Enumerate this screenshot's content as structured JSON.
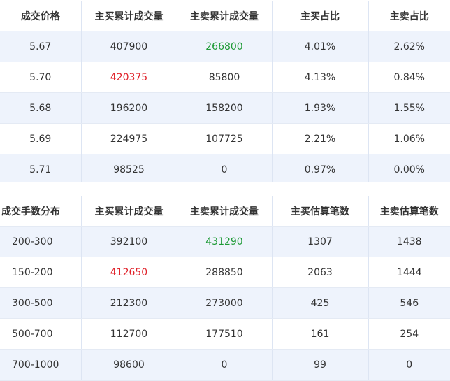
{
  "colors": {
    "up": "#e0222a",
    "down": "#1e9a36",
    "row_alt_bg": "#eef3fc"
  },
  "price_table": {
    "headers": [
      "成交价格",
      "主买累计成交量",
      "主卖累计成交量",
      "主买占比",
      "主卖占比"
    ],
    "rows": [
      {
        "price": "5.67",
        "buy_volume": "407900",
        "sell_volume": "266800",
        "buy_ratio": "4.01%",
        "sell_ratio": "2.62%"
      },
      {
        "price": "5.70",
        "buy_volume": "420375",
        "sell_volume": "85800",
        "buy_ratio": "4.13%",
        "sell_ratio": "0.84%"
      },
      {
        "price": "5.68",
        "buy_volume": "196200",
        "sell_volume": "158200",
        "buy_ratio": "1.93%",
        "sell_ratio": "1.55%"
      },
      {
        "price": "5.69",
        "buy_volume": "224975",
        "sell_volume": "107725",
        "buy_ratio": "2.21%",
        "sell_ratio": "1.06%"
      },
      {
        "price": "5.71",
        "buy_volume": "98525",
        "sell_volume": "0",
        "buy_ratio": "0.97%",
        "sell_ratio": "0.00%"
      }
    ]
  },
  "lot_table": {
    "headers": [
      "成交手数分布",
      "主买累计成交量",
      "主卖累计成交量",
      "主买估算笔数",
      "主卖估算笔数"
    ],
    "rows": [
      {
        "range": "200-300",
        "buy_volume": "392100",
        "sell_volume": "431290",
        "buy_count": "1307",
        "sell_count": "1438"
      },
      {
        "range": "150-200",
        "buy_volume": "412650",
        "sell_volume": "288850",
        "buy_count": "2063",
        "sell_count": "1444"
      },
      {
        "range": "300-500",
        "buy_volume": "212300",
        "sell_volume": "273000",
        "buy_count": "425",
        "sell_count": "546"
      },
      {
        "range": "500-700",
        "buy_volume": "112700",
        "sell_volume": "177510",
        "buy_count": "161",
        "sell_count": "254"
      },
      {
        "range": "700-1000",
        "buy_volume": "98600",
        "sell_volume": "0",
        "buy_count": "99",
        "sell_count": "0"
      }
    ]
  }
}
